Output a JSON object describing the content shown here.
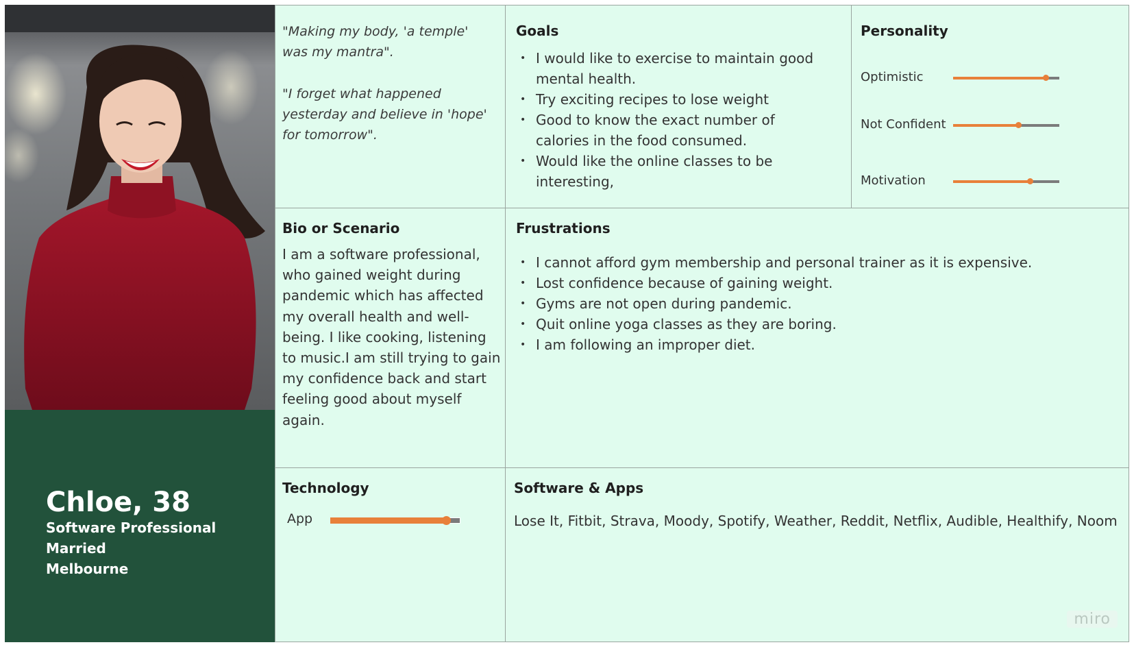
{
  "persona": {
    "name": "Chloe, 38",
    "occupation": "Software Professional",
    "status": "Married",
    "location": "Melbourne"
  },
  "quotes": {
    "line1": "\"Making my body, 'a temple'",
    "line2": "was my mantra\".",
    "line3": "\"I forget what happened",
    "line4": "yesterday and believe in 'hope'",
    "line5": "for tomorrow\"."
  },
  "goals": {
    "title": "Goals",
    "items": [
      "I would like to exercise to maintain good mental health.",
      "Try exciting recipes to lose weight",
      "Good to know the exact number of calories in the food consumed.",
      "Would like the online classes to be interesting,"
    ]
  },
  "personality": {
    "title": "Personality",
    "traits": [
      {
        "label": "Optimistic",
        "value": 0.87
      },
      {
        "label": "Not Confident",
        "value": 0.61
      },
      {
        "label": "Motivation",
        "value": 0.72
      }
    ]
  },
  "bio": {
    "title": "Bio or Scenario",
    "text": "I am a software professional, who gained weight during pandemic which has affected my overall health and well-being. I like cooking, listening to music.I am still trying to gain my confidence back and start feeling good about myself again."
  },
  "frustrations": {
    "title": "Frustrations",
    "items": [
      "I cannot afford gym membership and personal trainer as it is expensive.",
      "Lost confidence because of gaining weight.",
      "Gyms are not open during pandemic.",
      "Quit online yoga classes as they are boring.",
      "I am following an improper diet."
    ]
  },
  "technology": {
    "title": "Technology",
    "items": [
      {
        "label": "App",
        "value": 0.89
      }
    ]
  },
  "software": {
    "title": "Software & Apps",
    "text": "Lose It, Fitbit, Strava, Moody, Spotify, Weather, Reddit, Netflix, Audible, Healthify, Noom"
  },
  "watermark": "miro",
  "colors": {
    "card_bg": "#e0fcee",
    "identity_bg": "#22523b",
    "slider_fill": "#e8803a",
    "slider_track": "#7b7b7b"
  }
}
